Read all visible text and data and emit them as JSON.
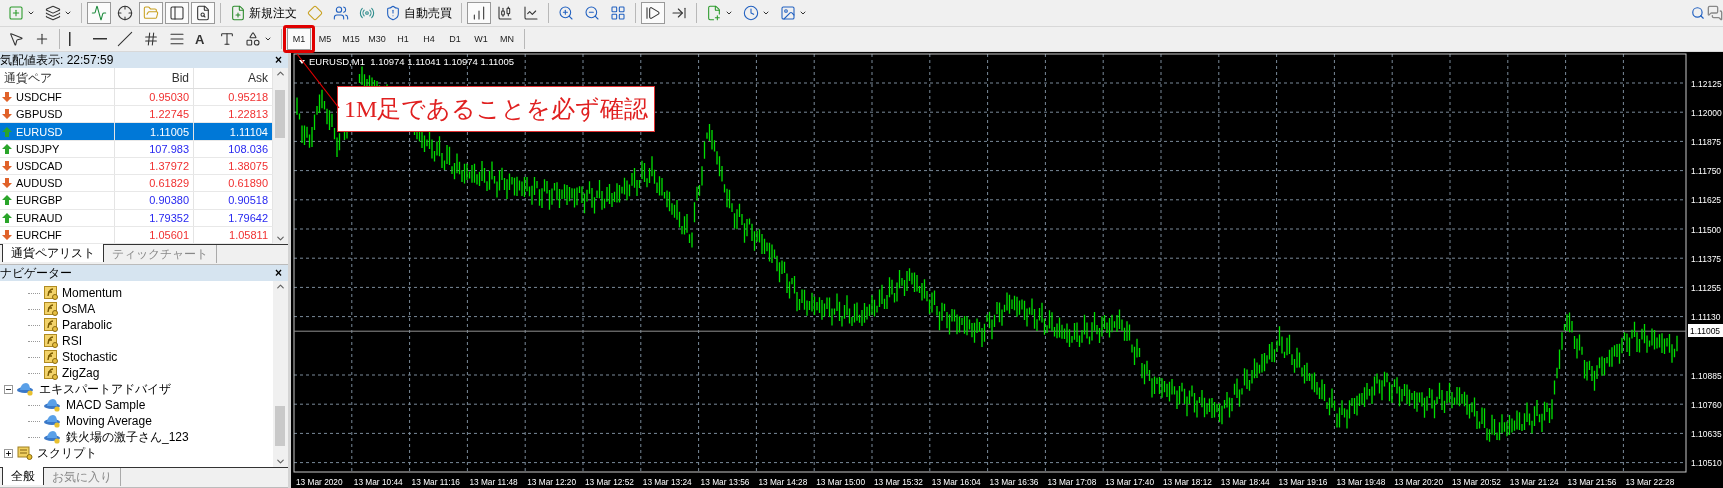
{
  "toolbar": {
    "items": [
      {
        "kind": "new-chart",
        "pressed": false
      },
      {
        "kind": "profiles",
        "pressed": false
      },
      {
        "kind": "separator"
      },
      {
        "kind": "market-watch",
        "pressed": true
      },
      {
        "kind": "data-window",
        "pressed": false
      },
      {
        "kind": "navigator",
        "pressed": true
      },
      {
        "kind": "terminal",
        "pressed": true
      },
      {
        "kind": "tester",
        "pressed": true
      },
      {
        "kind": "separator"
      },
      {
        "kind": "new-order",
        "label": "新規注文",
        "pressed": false
      },
      {
        "kind": "editor",
        "pressed": false
      },
      {
        "kind": "signals",
        "pressed": false
      },
      {
        "kind": "community",
        "pressed": false
      },
      {
        "kind": "auto-trading",
        "label": "自動売買",
        "pressed": false
      },
      {
        "kind": "separator"
      },
      {
        "kind": "bar-chart",
        "pressed": true
      },
      {
        "kind": "candles",
        "pressed": false
      },
      {
        "kind": "line-chart",
        "pressed": false
      },
      {
        "kind": "separator"
      },
      {
        "kind": "zoom-in",
        "pressed": false
      },
      {
        "kind": "zoom-out",
        "pressed": false
      },
      {
        "kind": "tile",
        "pressed": false
      },
      {
        "kind": "separator"
      },
      {
        "kind": "autoscroll",
        "pressed": true
      },
      {
        "kind": "chart-shift",
        "pressed": false
      },
      {
        "kind": "separator"
      },
      {
        "kind": "indicators",
        "pressed": false
      },
      {
        "kind": "periods",
        "pressed": false
      },
      {
        "kind": "templates",
        "pressed": false
      }
    ]
  },
  "drawing_tools": [
    {
      "kind": "cursor",
      "pressed": false
    },
    {
      "kind": "crosshair",
      "pressed": false
    },
    {
      "kind": "separator"
    },
    {
      "kind": "vertical-line",
      "pressed": false
    },
    {
      "kind": "horizontal-line",
      "pressed": false
    },
    {
      "kind": "trend-line",
      "pressed": false
    },
    {
      "kind": "channel",
      "pressed": false
    },
    {
      "kind": "fibonacci",
      "pressed": false
    },
    {
      "kind": "text",
      "label": "A",
      "pressed": false
    },
    {
      "kind": "label",
      "pressed": false
    },
    {
      "kind": "shapes",
      "pressed": false
    }
  ],
  "periods": [
    {
      "label": "M1",
      "selected": true
    },
    {
      "label": "M5",
      "selected": false
    },
    {
      "label": "M15",
      "selected": false
    },
    {
      "label": "M30",
      "selected": false
    },
    {
      "label": "H1",
      "selected": false
    },
    {
      "label": "H4",
      "selected": false
    },
    {
      "label": "D1",
      "selected": false
    },
    {
      "label": "W1",
      "selected": false
    },
    {
      "label": "MN",
      "selected": false
    }
  ],
  "market_watch": {
    "title": "気配値表示: 22:57:59",
    "close": "×",
    "columns": [
      "通貨ペア",
      "Bid",
      "Ask"
    ],
    "rows": [
      {
        "symbol": "USDCHF",
        "bid": "0.95030",
        "ask": "0.95218",
        "kind": "down",
        "selected": false
      },
      {
        "symbol": "GBPUSD",
        "bid": "1.22745",
        "ask": "1.22813",
        "kind": "down",
        "selected": false
      },
      {
        "symbol": "EURUSD",
        "bid": "1.11005",
        "ask": "1.11104",
        "kind": "up",
        "selected": true
      },
      {
        "symbol": "USDJPY",
        "bid": "107.983",
        "ask": "108.036",
        "kind": "up",
        "selected": false
      },
      {
        "symbol": "USDCAD",
        "bid": "1.37972",
        "ask": "1.38075",
        "kind": "down",
        "selected": false
      },
      {
        "symbol": "AUDUSD",
        "bid": "0.61829",
        "ask": "0.61890",
        "kind": "down",
        "selected": false
      },
      {
        "symbol": "EURGBP",
        "bid": "0.90380",
        "ask": "0.90518",
        "kind": "up",
        "selected": false
      },
      {
        "symbol": "EURAUD",
        "bid": "1.79352",
        "ask": "1.79642",
        "kind": "up",
        "selected": false
      },
      {
        "symbol": "EURCHF",
        "bid": "1.05601",
        "ask": "1.05811",
        "kind": "down",
        "selected": false
      }
    ],
    "tabs": [
      {
        "label": "通貨ペアリスト",
        "selected": true
      },
      {
        "label": "ティックチャート",
        "selected": false
      }
    ]
  },
  "navigator": {
    "title": "ナビゲーター",
    "close": "×",
    "indicators": [
      "Momentum",
      "OsMA",
      "Parabolic",
      "RSI",
      "Stochastic",
      "ZigZag"
    ],
    "tree": [
      {
        "label": "エキスパートアドバイザ",
        "kind": "experts",
        "expanded": true,
        "children": [
          {
            "label": "MACD Sample",
            "kind": "expert"
          },
          {
            "label": "Moving Average",
            "kind": "expert"
          },
          {
            "label": "鉄火場の激子さん_123",
            "kind": "expert"
          }
        ]
      },
      {
        "label": "スクリプト",
        "kind": "scripts",
        "expanded": false
      }
    ],
    "tabs": [
      {
        "label": "全般",
        "selected": true
      },
      {
        "label": "お気に入り",
        "selected": false
      }
    ]
  },
  "chart": {
    "title": "EURUSD,M1  1.10974 1.11041 1.10974 1.11005",
    "price_axis": [
      "1.12125",
      "1.12000",
      "1.11875",
      "1.11750",
      "1.11625",
      "1.11500",
      "1.11375",
      "1.11255",
      "1.11130",
      "1.10885",
      "1.10760",
      "1.10635",
      "1.10510"
    ],
    "current_price": "1.11005",
    "time_axis": [
      "13 Mar 2020",
      "13 Mar 10:44",
      "13 Mar 11:16",
      "13 Mar 11:48",
      "13 Mar 12:20",
      "13 Mar 12:52",
      "13 Mar 13:24",
      "13 Mar 13:56",
      "13 Mar 14:28",
      "13 Mar 15:00",
      "13 Mar 15:32",
      "13 Mar 16:04",
      "13 Mar 16:36",
      "13 Mar 17:08",
      "13 Mar 17:40",
      "13 Mar 18:12",
      "13 Mar 18:44",
      "13 Mar 19:16",
      "13 Mar 19:48",
      "13 Mar 20:20",
      "13 Mar 20:52",
      "13 Mar 21:24",
      "13 Mar 21:56",
      "13 Mar 22:28"
    ]
  },
  "annotation": {
    "text": "1M足であることを必ず確認"
  }
}
